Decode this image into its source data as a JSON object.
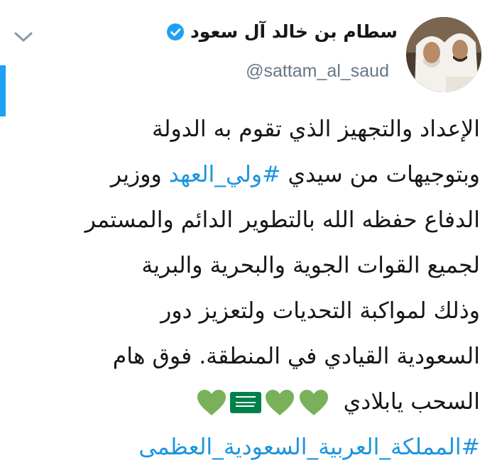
{
  "tweet": {
    "author": {
      "display_name": "سطام بن خالد آل سعود",
      "handle": "@sattam_al_saud",
      "verified": true
    },
    "body_lines": [
      {
        "parts": [
          {
            "text": "الإعداد والتجهيز الذي تقوم به الدولة",
            "type": "text"
          }
        ]
      },
      {
        "parts": [
          {
            "text": "وبتوجيهات من سيدي ",
            "type": "text"
          },
          {
            "text": "#ولي_العهد",
            "type": "hashtag"
          },
          {
            "text": " ووزير",
            "type": "text"
          }
        ]
      },
      {
        "parts": [
          {
            "text": "الدفاع حفظه الله بالتطوير الدائم والمستمر",
            "type": "text"
          }
        ]
      },
      {
        "parts": [
          {
            "text": "لجميع القوات الجوية والبحرية والبرية",
            "type": "text"
          }
        ]
      },
      {
        "parts": [
          {
            "text": "وذلك لمواكبة التحديات ولتعزيز دور",
            "type": "text"
          }
        ]
      },
      {
        "parts": [
          {
            "text": "السعودية القيادي في المنطقة. فوق هام",
            "type": "text"
          }
        ]
      },
      {
        "parts": [
          {
            "text": "السحب يابلادي",
            "type": "text"
          }
        ]
      },
      {
        "parts": [
          {
            "text": "#المملكة_العربية_السعودية_العظمى",
            "type": "hashtag"
          }
        ]
      }
    ],
    "emojis": [
      "green-heart",
      "saudi-flag",
      "green-heart",
      "green-heart"
    ],
    "colors": {
      "hashtag": "#1b95e0",
      "text": "#14171a",
      "handle": "#657786",
      "verified": "#1da1f2",
      "heart": "#78b159",
      "flag": "#00804a"
    }
  }
}
